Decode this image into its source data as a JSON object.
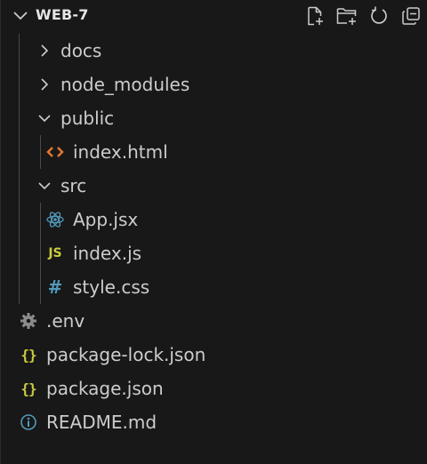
{
  "header": {
    "title": "WEB-7",
    "actions": [
      {
        "name": "new-file-icon"
      },
      {
        "name": "new-folder-icon"
      },
      {
        "name": "refresh-icon"
      },
      {
        "name": "collapse-all-icon"
      }
    ]
  },
  "tree": {
    "docs": "docs",
    "node_modules": "node_modules",
    "public": "public",
    "index_html": "index.html",
    "src": "src",
    "app_jsx": "App.jsx",
    "index_js": "index.js",
    "style_css": "style.css",
    "env": ".env",
    "package_lock": "package-lock.json",
    "package_json": "package.json",
    "readme": "README.md"
  },
  "icons": {
    "js_glyph": "JS",
    "css_glyph": "#",
    "json_glyph": "{}"
  },
  "colors": {
    "background": "#181818",
    "text": "#cccccc",
    "html_icon": "#e37933",
    "react_icon": "#519aba",
    "js_icon": "#cbcb41",
    "css_icon": "#519aba",
    "json_icon": "#cbcb41",
    "info_icon": "#519aba",
    "gear_icon": "#8c8c8c"
  }
}
